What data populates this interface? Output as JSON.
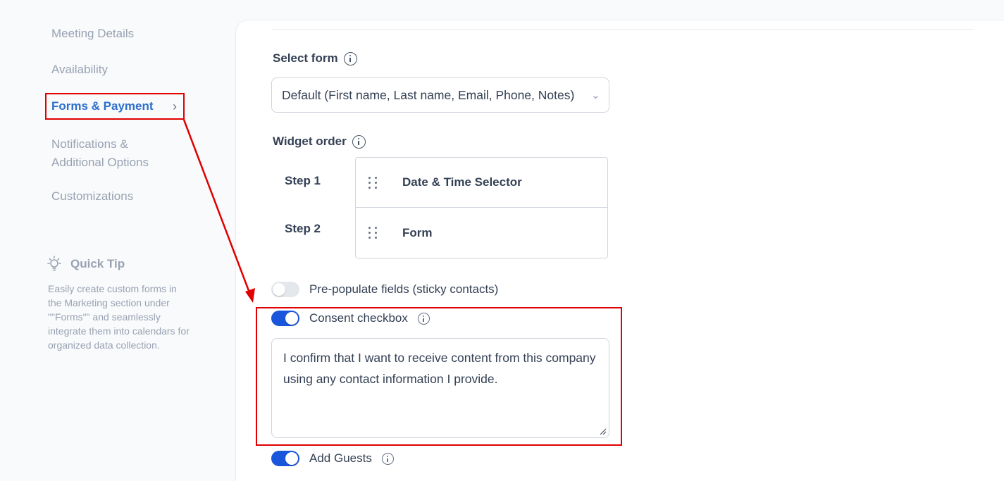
{
  "sidebar": {
    "items": [
      {
        "label": "Meeting Details"
      },
      {
        "label": "Availability"
      },
      {
        "label": "Forms & Payment"
      },
      {
        "label": "Notifications & Additional Options"
      },
      {
        "label": "Customizations"
      }
    ],
    "active_index": 2,
    "quick_tip": {
      "title": "Quick Tip",
      "body": "Easily create custom forms in the Marketing section under \"\"Forms\"\" and seamlessly integrate them into calendars for organized data collection."
    }
  },
  "main": {
    "select_form": {
      "label": "Select form",
      "value": "Default (First name, Last name, Email, Phone, Notes)"
    },
    "widget_order": {
      "label": "Widget order",
      "steps": [
        {
          "step": "Step 1",
          "widget": "Date & Time Selector"
        },
        {
          "step": "Step 2",
          "widget": "Form"
        }
      ]
    },
    "toggles": {
      "prepopulate": {
        "label": "Pre-populate fields (sticky contacts)",
        "on": false
      },
      "consent": {
        "label": "Consent checkbox",
        "on": true,
        "text": "I confirm that I want to receive content from this company using any contact information I provide."
      },
      "add_guests": {
        "label": "Add Guests",
        "on": true
      }
    }
  },
  "colors": {
    "accent": "#1a56db",
    "active_nav": "#2c6ecb",
    "annotation": "#e00000"
  }
}
